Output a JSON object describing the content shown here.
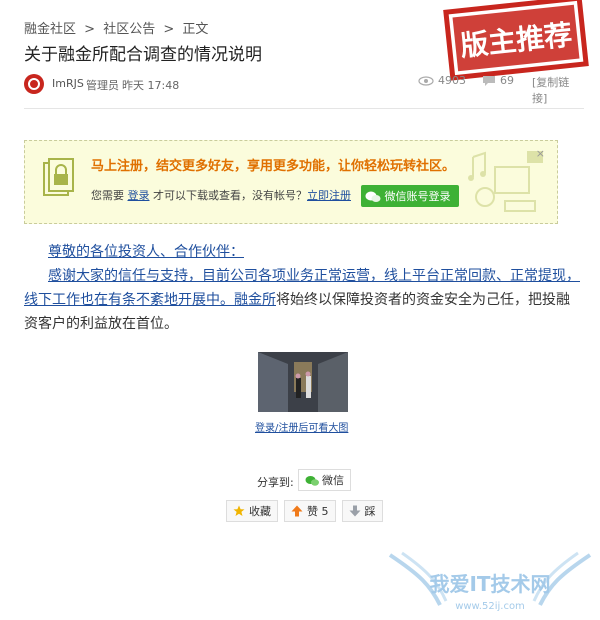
{
  "breadcrumb": {
    "items": [
      "融金社区",
      "社区公告",
      "正文"
    ],
    "separator": ">"
  },
  "thread": {
    "title": "关于融金所配合调查的情况说明",
    "stamp_text": "版主推荐",
    "author": "ImRJS",
    "role": "管理员",
    "time": "昨天 17:48",
    "views": "4903",
    "replies": "69",
    "copy_link": "[复制链接]"
  },
  "register_banner": {
    "title": "马上注册，结交更多好友，享用更多功能，让你轻松玩转社区。",
    "prompt_prefix": "您需要",
    "login_link": "登录",
    "prompt_middle": "才可以下载或查看，没有帐号？",
    "register_link": "立即注册",
    "wechat_login": "微信账号登录",
    "close": "×"
  },
  "post": {
    "line1": "尊敬的各位投资人、合作伙伴：",
    "para_link": "感谢大家的信任与支持，目前公司各项业务正常运营，线上平台正常回款、正常提现，线下工作也在有条不紊地开展中。",
    "link2": "融金所",
    "para_rest": "将始终以保障投资者的资金安全为己任，把投融资客户的利益放在首位。",
    "image_caption": "登录/注册后可看大图"
  },
  "share": {
    "label": "分享到:",
    "wechat": "微信"
  },
  "actions": {
    "favorite": "收藏",
    "like": "赞 5",
    "dislike": "踩"
  },
  "watermark": {
    "text": "我爱IT技术网",
    "url": "www.52ij.com"
  },
  "colors": {
    "link": "#1f4f9e",
    "accent_orange": "#e07000",
    "wechat_green": "#3eb135",
    "stamp_red": "#c8261e"
  }
}
